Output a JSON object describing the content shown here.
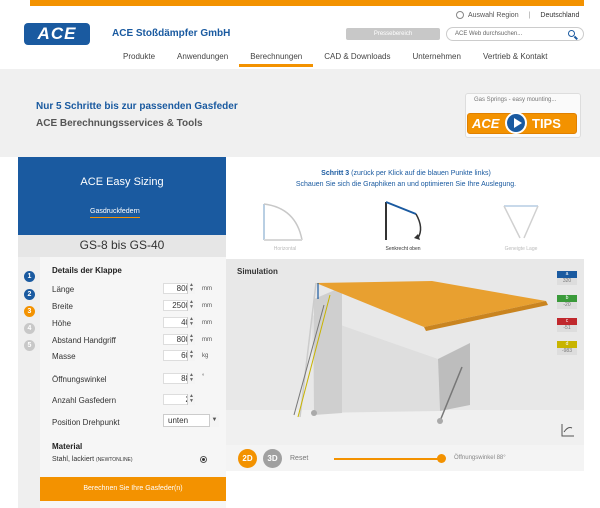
{
  "header": {
    "logo_text": "ACE",
    "company": "ACE Stoßdämpfer GmbH",
    "region_label": "Auswahl Region",
    "region_value": "Deutschland",
    "top_button": "Pressebereich",
    "search_placeholder": "ACE Web durchsuchen..."
  },
  "nav": [
    "Produkte",
    "Anwendungen",
    "Berechnungen",
    "CAD & Downloads",
    "Unternehmen",
    "Vertrieb & Kontakt"
  ],
  "hero": {
    "title": "Nur 5 Schritte bis zur passenden Gasfeder",
    "subtitle": "ACE Berechnungsservices & Tools",
    "tips_label": "Gas Springs - easy mounting...",
    "tips_ace": "ACE",
    "tips_text": "TIPS"
  },
  "sizing": {
    "title": "ACE Easy Sizing",
    "tab": "Gasdruckfedern",
    "model": "GS-8 bis GS-40",
    "steps": [
      "1",
      "2",
      "3",
      "4",
      "5"
    ]
  },
  "form": {
    "title": "Details der Klappe",
    "rows": [
      {
        "label": "Länge",
        "value": "800",
        "unit": "mm"
      },
      {
        "label": "Breite",
        "value": "2500",
        "unit": "mm"
      },
      {
        "label": "Höhe",
        "value": "40",
        "unit": "mm"
      },
      {
        "label": "Abstand Handgriff",
        "value": "800",
        "unit": "mm"
      },
      {
        "label": "Masse",
        "value": "60",
        "unit": "kg"
      },
      {
        "label": "Öffnungswinkel",
        "value": "88",
        "unit": "°"
      },
      {
        "label": "Anzahl Gasfedern",
        "value": "2",
        "unit": ""
      }
    ],
    "pivot_label": "Position Drehpunkt",
    "pivot_value": "unten",
    "material_title": "Material",
    "material_option": "Stahl, lackiert",
    "material_code": "(NEWTONLINE)",
    "calc_button": "Berechnen Sie Ihre Gasfeder(n)"
  },
  "step3": {
    "line1_prefix": "Schritt 3",
    "line1_rest": " (zurück per Klick auf die blauen Punkte links)",
    "line2": "Schauen Sie sich die Graphiken an und optimieren Sie Ihre Auslegung.",
    "options": [
      "Horizontal",
      "Senkrecht oben",
      "Geneigte Lage"
    ]
  },
  "simulation": {
    "title": "Simulation",
    "legend": [
      {
        "key": "a",
        "value": "320",
        "color": "#1a5aa0"
      },
      {
        "key": "b",
        "value": "-20",
        "color": "#3a9a3a"
      },
      {
        "key": "c",
        "value": "-51",
        "color": "#c0282d"
      },
      {
        "key": "d",
        "value": "-983",
        "color": "#c8b400"
      }
    ],
    "btn_2d": "2D",
    "btn_3d": "3D",
    "reset": "Reset",
    "angle_label": "Öffnungswinkel 88°",
    "angle_fraction": 0.98
  }
}
